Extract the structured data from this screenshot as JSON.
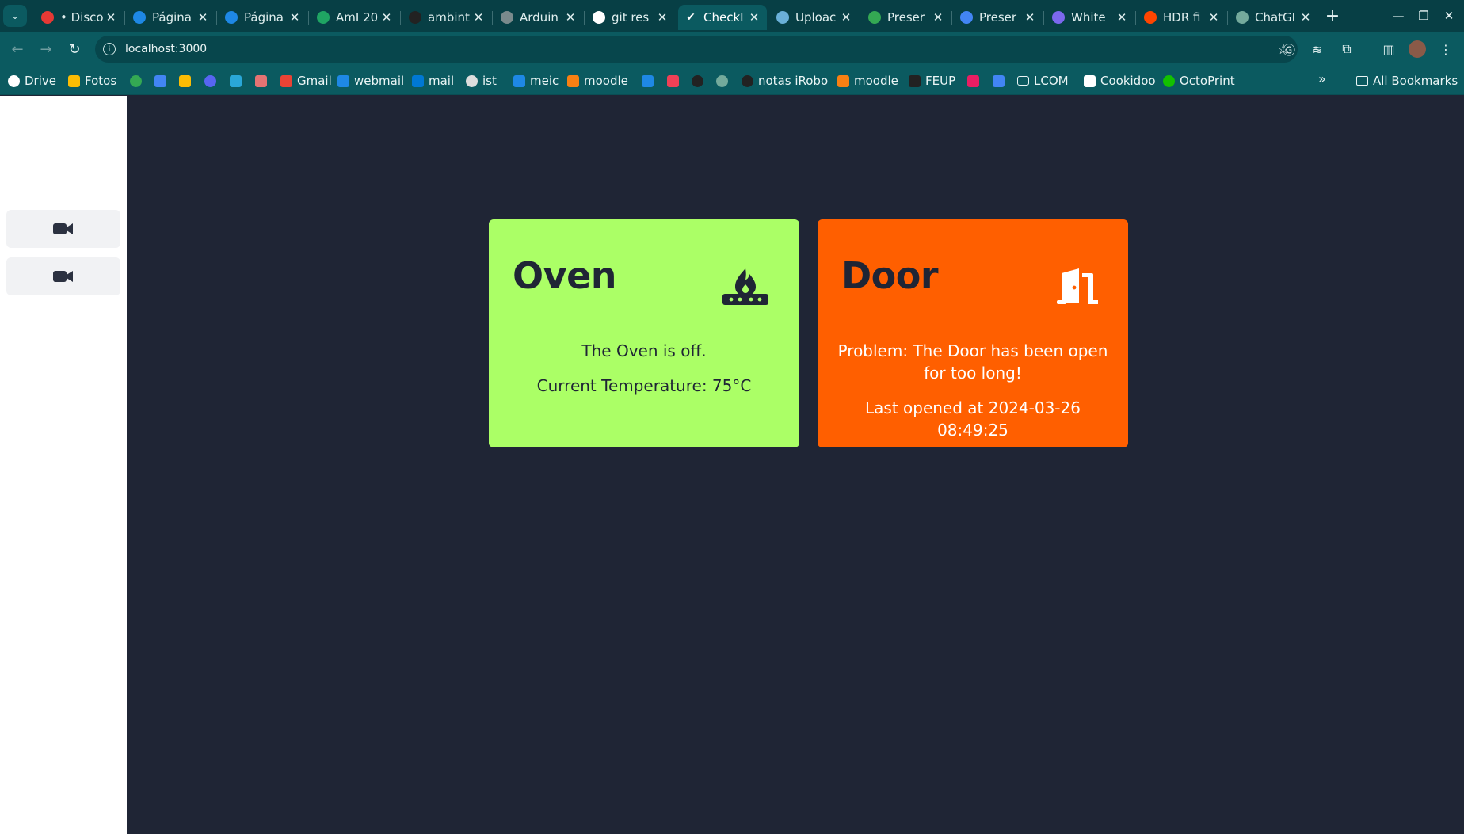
{
  "browser": {
    "tabs": [
      {
        "title": "• Disco",
        "favicon": "discord-icon",
        "color": "#e53935"
      },
      {
        "title": "Página",
        "favicon": "shield-icon",
        "color": "#1e88e5"
      },
      {
        "title": "Página",
        "favicon": "shield-icon",
        "color": "#1e88e5"
      },
      {
        "title": "AmI 20",
        "favicon": "sheets-icon",
        "color": "#1fa463"
      },
      {
        "title": "ambint",
        "favicon": "github-icon",
        "color": "#222222"
      },
      {
        "title": "Arduin",
        "favicon": "globe-icon",
        "color": "#7a8a8c"
      },
      {
        "title": "git res",
        "favicon": "google-icon",
        "color": "#ffffff"
      },
      {
        "title": "CheckI",
        "favicon": "check-icon",
        "color": "#0b5a60",
        "active": true
      },
      {
        "title": "Uploac",
        "favicon": "infinity-icon",
        "color": "#6ab0d8"
      },
      {
        "title": "Preser",
        "favicon": "drive-icon",
        "color": "#34a853"
      },
      {
        "title": "Preser",
        "favicon": "docs-icon",
        "color": "#4285f4"
      },
      {
        "title": "White",
        "favicon": "shield-icon",
        "color": "#7b68ee"
      },
      {
        "title": "HDR fi",
        "favicon": "reddit-icon",
        "color": "#ff4500"
      },
      {
        "title": "ChatGI",
        "favicon": "chatgpt-icon",
        "color": "#74aa9c"
      }
    ],
    "close_glyph": "✕",
    "new_tab_glyph": "+",
    "url": "localhost:3000",
    "bookmarks": [
      {
        "label": "Drive",
        "icon": "google-icon",
        "color": "#ffffff"
      },
      {
        "label": "Fotos",
        "icon": "photos-icon",
        "color": "#fbbc04"
      },
      {
        "label": "",
        "icon": "maps-icon",
        "color": "#34a853"
      },
      {
        "label": "",
        "icon": "calendar-icon",
        "color": "#4285f4"
      },
      {
        "label": "",
        "icon": "keep-icon",
        "color": "#fbbc04"
      },
      {
        "label": "",
        "icon": "discord-icon",
        "color": "#5865f2"
      },
      {
        "label": "",
        "icon": "wave-icon",
        "color": "#2aa7d8"
      },
      {
        "label": "",
        "icon": "person-icon",
        "color": "#e57373"
      },
      {
        "label": "Gmail",
        "icon": "gmail-icon",
        "color": "#ea4335"
      },
      {
        "label": "webmail",
        "icon": "shield-icon",
        "color": "#1e88e5"
      },
      {
        "label": "mail",
        "icon": "outlook-icon",
        "color": "#0078d4"
      },
      {
        "label": "ist",
        "icon": "globe-icon",
        "color": "#dddddd"
      },
      {
        "label": "meic",
        "icon": "shield-icon",
        "color": "#1e88e5"
      },
      {
        "label": "moodle",
        "icon": "moodle-icon",
        "color": "#f98012"
      },
      {
        "label": "",
        "icon": "shield-icon",
        "color": "#1e88e5"
      },
      {
        "label": "",
        "icon": "pocket-icon",
        "color": "#ef4056"
      },
      {
        "label": "",
        "icon": "github-icon",
        "color": "#222222"
      },
      {
        "label": "",
        "icon": "chatgpt-icon",
        "color": "#74aa9c"
      },
      {
        "label": "notas iRobo",
        "icon": "github-icon",
        "color": "#222222"
      },
      {
        "label": "moodle",
        "icon": "moodle-icon",
        "color": "#f98012"
      },
      {
        "label": "FEUP",
        "icon": "feup-icon",
        "color": "#222222"
      },
      {
        "label": "",
        "icon": "app-icon",
        "color": "#e91e63"
      },
      {
        "label": "",
        "icon": "translate-icon",
        "color": "#4285f4"
      },
      {
        "label": "LCOM",
        "icon": "folder-icon",
        "color": "#0b5a60"
      },
      {
        "label": "Cookidoo",
        "icon": "cookidoo-icon",
        "color": "#ffffff"
      },
      {
        "label": "OctoPrint",
        "icon": "octoprint-icon",
        "color": "#13c100"
      }
    ],
    "more_glyph": "»",
    "all_bookmarks_label": "All Bookmarks"
  },
  "page": {
    "sidebar": {
      "buttons": [
        {
          "icon": "video-camera-icon"
        },
        {
          "icon": "video-camera-icon"
        }
      ]
    },
    "cards": {
      "oven": {
        "title": "Oven",
        "icon": "stove-fire-icon",
        "status": "The Oven is off.",
        "detail": "Current Temperature: 75°C",
        "color": "#abff66"
      },
      "door": {
        "title": "Door",
        "icon": "door-open-icon",
        "status": "Problem: The Door has been open for too long!",
        "detail": "Last opened at 2024-03-26 08:49:25",
        "color": "#ff5f00"
      }
    }
  }
}
